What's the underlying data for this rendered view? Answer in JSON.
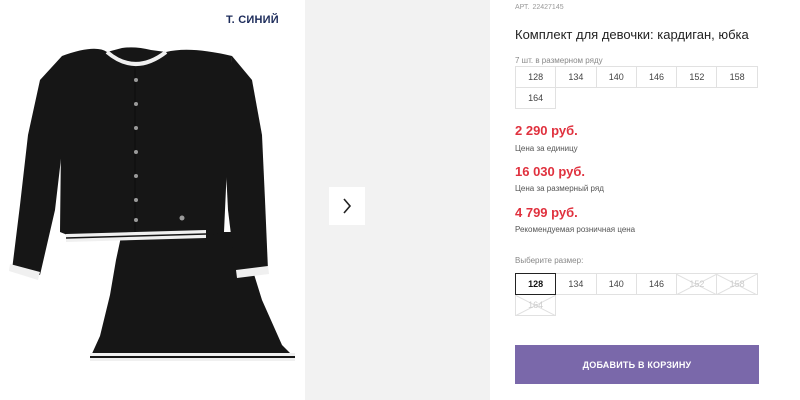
{
  "product": {
    "color": "т. синий",
    "article_label": "АРТ.",
    "article_number": "22427145",
    "title": "Комплект для девочки: кардиган, юбка"
  },
  "size_row": {
    "count_text": "7 шт. в размерном ряду",
    "sizes": [
      "128",
      "134",
      "140",
      "146",
      "152",
      "158",
      "164"
    ]
  },
  "prices": {
    "unit_price": "2 290 руб.",
    "unit_note": "Цена за единицу",
    "row_price": "16 030 руб.",
    "row_note": "Цена за размерный ряд",
    "retail_price": "4 799 руб.",
    "retail_note": "Рекомендуемая розничная цена"
  },
  "size_picker": {
    "label": "Выберите размер:",
    "options": [
      {
        "size": "128",
        "state": "selected"
      },
      {
        "size": "134",
        "state": "available"
      },
      {
        "size": "140",
        "state": "available"
      },
      {
        "size": "146",
        "state": "available"
      },
      {
        "size": "152",
        "state": "unavailable"
      },
      {
        "size": "158",
        "state": "unavailable"
      },
      {
        "size": "164",
        "state": "unavailable"
      }
    ]
  },
  "gallery": {
    "next_icon": "chevron-right-icon"
  },
  "cart": {
    "add_label": "ДОБАВИТЬ В КОРЗИНУ"
  },
  "colors": {
    "price": "#e0313e",
    "button": "#7a68aa",
    "color_label": "#1c2b5a",
    "gallery_bg": "#f2f2f2"
  }
}
